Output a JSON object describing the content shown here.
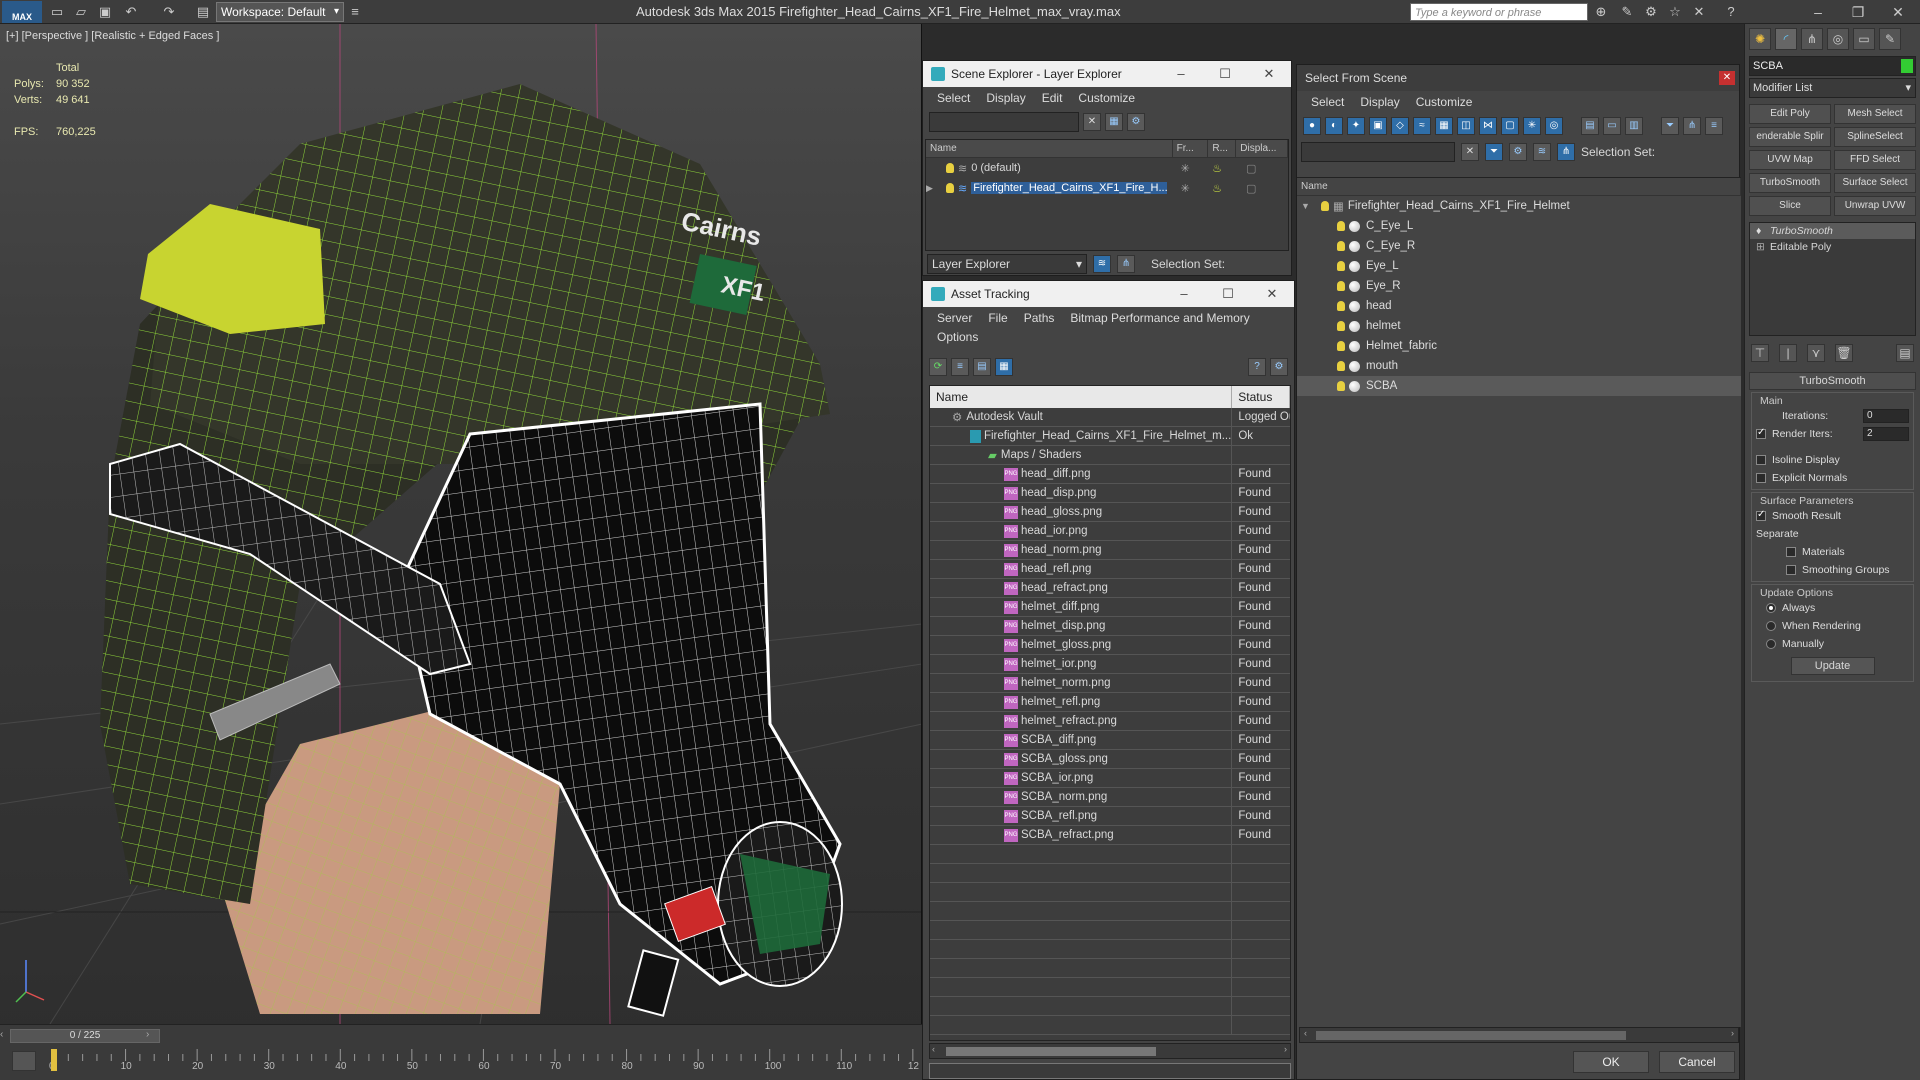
{
  "titlebar": {
    "logo": "MAX",
    "workspace": "Workspace: Default",
    "title": "Autodesk 3ds Max  2015     Firefighter_Head_Cairns_XF1_Fire_Helmet_max_vray.max",
    "search_placeholder": "Type a keyword or phrase"
  },
  "viewport": {
    "label": "[+] [Perspective ] [Realistic + Edged Faces ]",
    "stats": {
      "total_label": "Total",
      "polys_label": "Polys:",
      "polys": "90 352",
      "verts_label": "Verts:",
      "verts": "49 641",
      "fps_label": "FPS:",
      "fps": "760,225"
    },
    "helmet_text_brand": "Cairns",
    "helmet_text_model": "XF1"
  },
  "timeline": {
    "slider": "0 / 225",
    "ticks": [
      "0",
      "10",
      "20",
      "30",
      "40",
      "50",
      "60",
      "70",
      "80",
      "90",
      "100",
      "110",
      "12"
    ]
  },
  "scene_explorer": {
    "title": "Scene Explorer - Layer Explorer",
    "menu": [
      "Select",
      "Display",
      "Edit",
      "Customize"
    ],
    "columns": [
      "Name",
      "Fr...",
      "R...",
      "Displa..."
    ],
    "rows": [
      {
        "name": "0 (default)",
        "selected": false
      },
      {
        "name": "Firefighter_Head_Cairns_XF1_Fire_H...",
        "selected": true
      }
    ],
    "footer_dropdown": "Layer Explorer",
    "footer_selset": "Selection Set:"
  },
  "asset_tracking": {
    "title": "Asset Tracking",
    "menu": [
      "Server",
      "File",
      "Paths",
      "Bitmap Performance and Memory"
    ],
    "menu2": [
      "Options"
    ],
    "columns": [
      "Name",
      "Status"
    ],
    "vault": {
      "name": "Autodesk Vault",
      "status": "Logged Ou"
    },
    "file": {
      "name": "Firefighter_Head_Cairns_XF1_Fire_Helmet_m...",
      "status": "Ok"
    },
    "maps_group": "Maps / Shaders",
    "maps": [
      {
        "name": "head_diff.png",
        "status": "Found"
      },
      {
        "name": "head_disp.png",
        "status": "Found"
      },
      {
        "name": "head_gloss.png",
        "status": "Found"
      },
      {
        "name": "head_ior.png",
        "status": "Found"
      },
      {
        "name": "head_norm.png",
        "status": "Found"
      },
      {
        "name": "head_refl.png",
        "status": "Found"
      },
      {
        "name": "head_refract.png",
        "status": "Found"
      },
      {
        "name": "helmet_diff.png",
        "status": "Found"
      },
      {
        "name": "helmet_disp.png",
        "status": "Found"
      },
      {
        "name": "helmet_gloss.png",
        "status": "Found"
      },
      {
        "name": "helmet_ior.png",
        "status": "Found"
      },
      {
        "name": "helmet_norm.png",
        "status": "Found"
      },
      {
        "name": "helmet_refl.png",
        "status": "Found"
      },
      {
        "name": "helmet_refract.png",
        "status": "Found"
      },
      {
        "name": "SCBA_diff.png",
        "status": "Found"
      },
      {
        "name": "SCBA_gloss.png",
        "status": "Found"
      },
      {
        "name": "SCBA_ior.png",
        "status": "Found"
      },
      {
        "name": "SCBA_norm.png",
        "status": "Found"
      },
      {
        "name": "SCBA_refl.png",
        "status": "Found"
      },
      {
        "name": "SCBA_refract.png",
        "status": "Found"
      }
    ]
  },
  "select_from_scene": {
    "title": "Select From Scene",
    "menu": [
      "Select",
      "Display",
      "Customize"
    ],
    "selset": "Selection Set:",
    "column": "Name",
    "root": "Firefighter_Head_Cairns_XF1_Fire_Helmet",
    "objects": [
      "C_Eye_L",
      "C_Eye_R",
      "Eye_L",
      "Eye_R",
      "head",
      "helmet",
      "Helmet_fabric",
      "mouth",
      "SCBA"
    ],
    "selected_object": "SCBA",
    "ok": "OK",
    "cancel": "Cancel"
  },
  "command_panel": {
    "object_name": "SCBA",
    "modifier_list": "Modifier List",
    "buttons": [
      "Edit Poly",
      "Mesh Select",
      "enderable Splir",
      "SplineSelect",
      "UVW Map",
      "FFD Select",
      "TurboSmooth",
      "Surface Select",
      "Slice",
      "Unwrap UVW"
    ],
    "stack": [
      "TurboSmooth",
      "Editable Poly"
    ],
    "rollout_title": "TurboSmooth",
    "main_group": "Main",
    "iterations_label": "Iterations:",
    "iterations": "0",
    "render_iters_label": "Render Iters:",
    "render_iters": "2",
    "isoline": "Isoline Display",
    "explicit_normals": "Explicit Normals",
    "surface_group": "Surface Parameters",
    "smooth_result": "Smooth Result",
    "separate": "Separate",
    "materials": "Materials",
    "smoothing_groups": "Smoothing Groups",
    "update_group": "Update Options",
    "always": "Always",
    "when_rendering": "When Rendering",
    "manually": "Manually",
    "update_button": "Update"
  },
  "colors": {
    "wire_green": "#8fd63a",
    "selection_blue": "#2e5f99",
    "helmet_yellow": "#c8d430",
    "skin": "#c99a80"
  }
}
